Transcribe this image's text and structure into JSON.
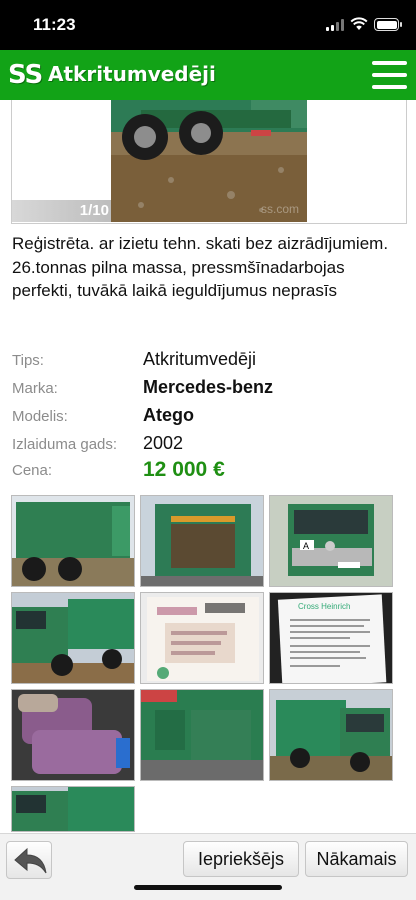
{
  "status_bar": {
    "time": "11:23"
  },
  "header": {
    "logo": "SS",
    "title": "Atkritumvedēji"
  },
  "gallery": {
    "counter": "1/10",
    "watermark": "ss.com"
  },
  "description": "Reģistrēta. ar izietu tehn. skati bez aizrādījumiem. 26.tonnas pilna massa, pressmšīnadarbojas perfekti, tuvākā laikā ieguldījumus neprasīs",
  "specs": [
    {
      "label": "Tips:",
      "value": "Atkritumvedēji"
    },
    {
      "label": "Marka:",
      "value": "Mercedes-benz"
    },
    {
      "label": "Modelis:",
      "value": "Atego"
    },
    {
      "label": "Izlaiduma gads:",
      "value": "2002"
    },
    {
      "label": "Cena:",
      "value": "12 000 €"
    }
  ],
  "thumbnails": {
    "count": 10,
    "plate_text": "A",
    "doc_text": "Cross Heinrich"
  },
  "toolbar": {
    "back_icon": "reply-arrow-icon",
    "prev_label": "Iepriekšējs",
    "next_label": "Nākamais"
  },
  "colors": {
    "brand_green": "#12a317",
    "price_green": "#1f8f13",
    "truck_green": "#2f7f52"
  }
}
